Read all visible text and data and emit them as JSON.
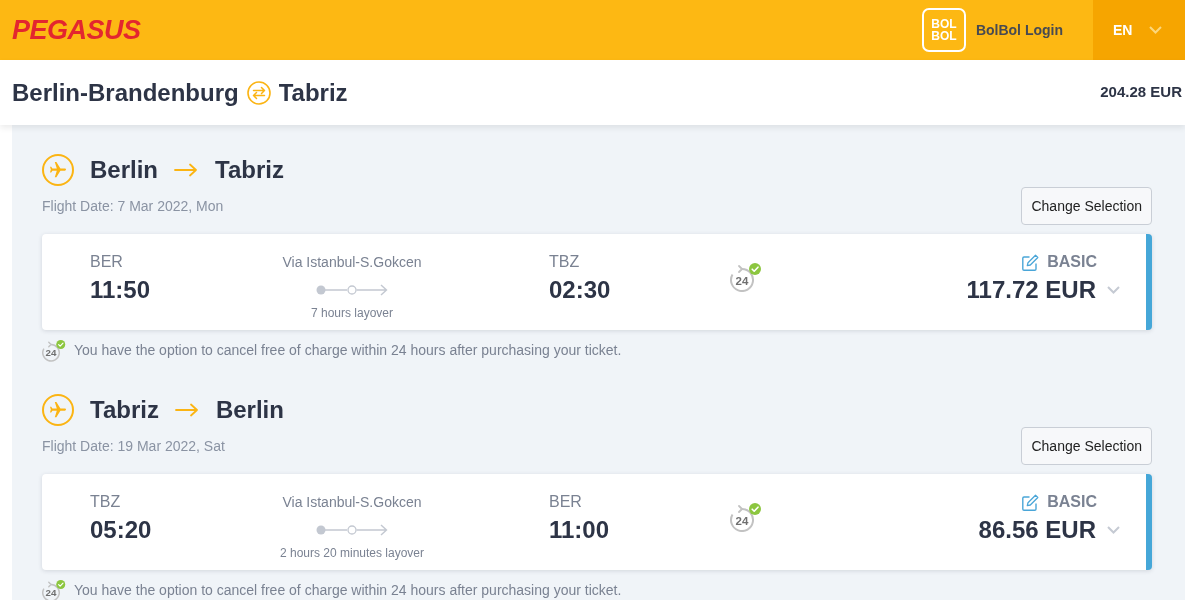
{
  "header": {
    "logo": "PEGASUS",
    "member_badge": [
      "BOL",
      "BOL"
    ],
    "login_link": "BolBol Login",
    "language": "EN"
  },
  "trip": {
    "origin": "Berlin-Brandenburg",
    "destination": "Tabriz",
    "total_price": "204.28 EUR"
  },
  "legs": [
    {
      "from": "Berlin",
      "to": "Tabriz",
      "flight_date": "Flight Date: 7 Mar 2022, Mon",
      "change_button": "Change Selection",
      "flight": {
        "departure_code": "BER",
        "departure_time": "11:50",
        "via": "Via Istanbul-S.Gokcen",
        "layover": "7 hours layover",
        "arrival_code": "TBZ",
        "arrival_time": "02:30",
        "cancel_icon_text": "24",
        "fare": "BASIC",
        "price": "117.72 EUR"
      },
      "note_icon_text": "24",
      "note": "You have the option to cancel free of charge within 24 hours after purchasing your ticket."
    },
    {
      "from": "Tabriz",
      "to": "Berlin",
      "flight_date": "Flight Date: 19 Mar 2022, Sat",
      "change_button": "Change Selection",
      "flight": {
        "departure_code": "TBZ",
        "departure_time": "05:20",
        "via": "Via Istanbul-S.Gokcen",
        "layover": "2 hours 20 minutes layover",
        "arrival_code": "BER",
        "arrival_time": "11:00",
        "cancel_icon_text": "24",
        "fare": "BASIC",
        "price": "86.56 EUR"
      },
      "note_icon_text": "24",
      "note": "You have the option to cancel free of charge within 24 hours after purchasing your ticket."
    }
  ]
}
